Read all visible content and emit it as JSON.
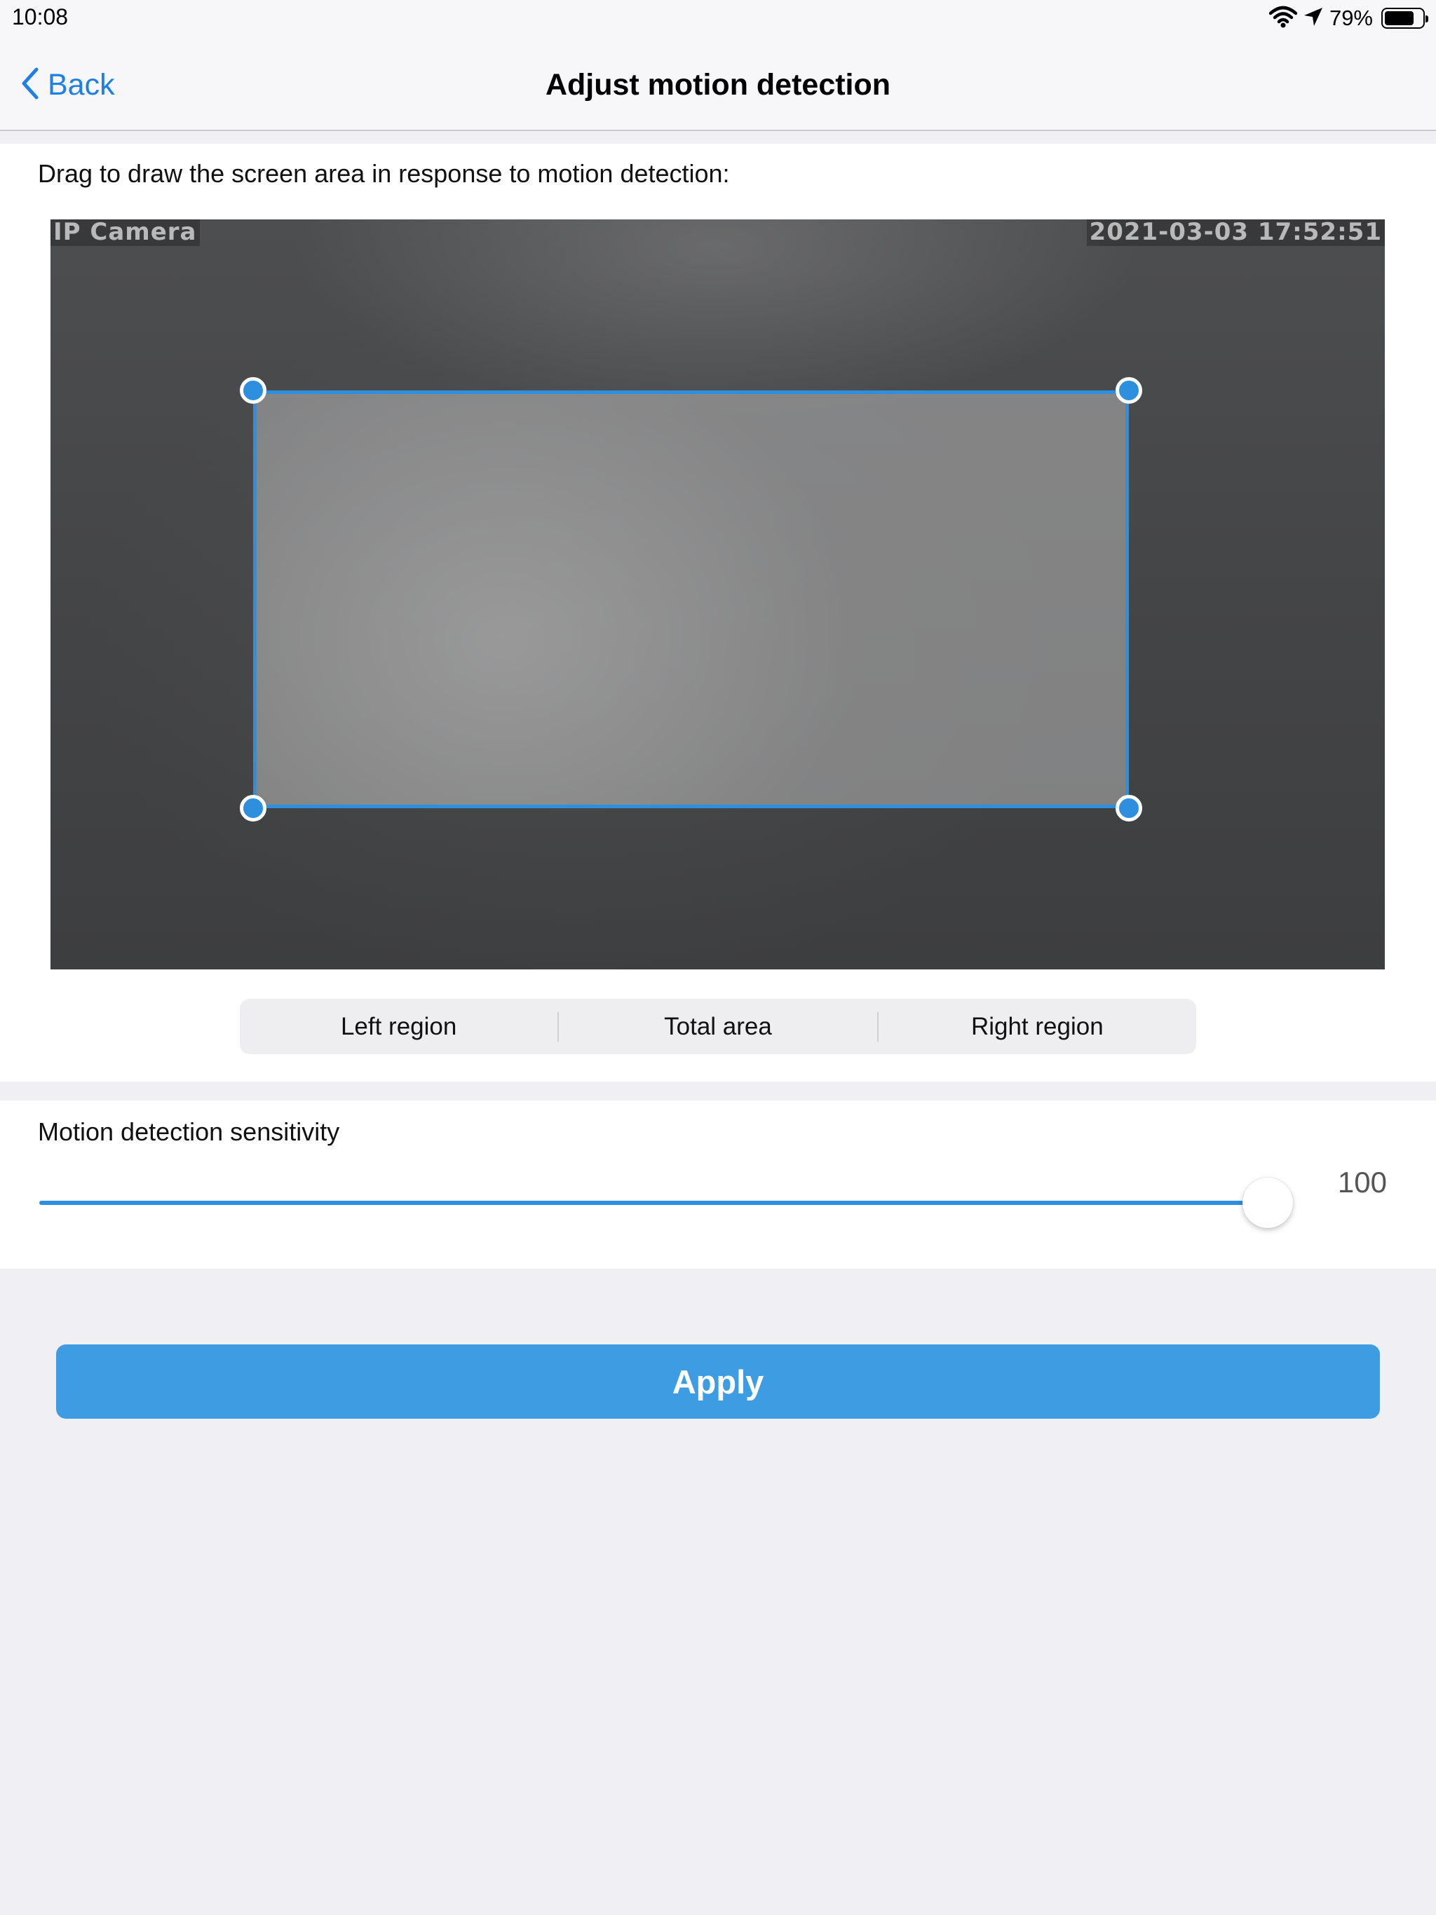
{
  "status_bar": {
    "time": "10:08",
    "battery_percent_label": "79%",
    "battery_level": 0.79,
    "icons": [
      "wifi-icon",
      "location-arrow-icon",
      "battery-icon"
    ]
  },
  "nav": {
    "back_label": "Back",
    "title": "Adjust motion detection"
  },
  "region": {
    "instruction": "Drag to draw the screen area in response to motion detection:",
    "camera_name": "IP Camera",
    "camera_timestamp": "2021-03-03 17:52:51",
    "segments": [
      "Left region",
      "Total area",
      "Right region"
    ]
  },
  "sensitivity": {
    "label": "Motion detection sensitivity",
    "value": 100,
    "max": 100,
    "value_label": "100"
  },
  "actions": {
    "apply_label": "Apply"
  },
  "colors": {
    "accent": "#2f8fdf",
    "button": "#3d9ce2",
    "link": "#1f7fe6",
    "background": "#efeff4"
  }
}
